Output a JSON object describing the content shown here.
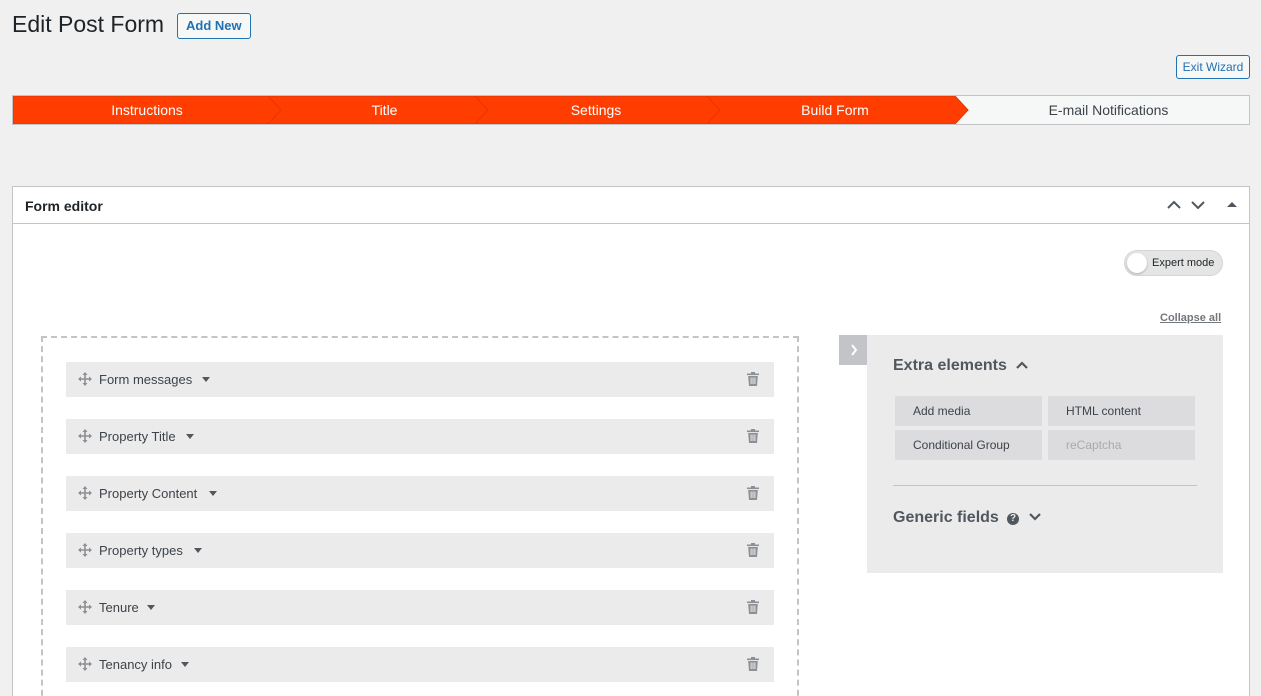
{
  "page": {
    "title": "Edit Post Form",
    "add_new_label": "Add New",
    "exit_wizard_label": "Exit Wizard"
  },
  "wizard": {
    "steps": [
      {
        "label": "Instructions",
        "active": true
      },
      {
        "label": "Title",
        "active": true
      },
      {
        "label": "Settings",
        "active": true
      },
      {
        "label": "Build Form",
        "active": true
      },
      {
        "label": "E-mail Notifications",
        "active": false
      }
    ],
    "active_color": "#ff3d00"
  },
  "form_editor": {
    "title": "Form editor",
    "expert_mode_label": "Expert mode",
    "collapse_all_label": "Collapse all",
    "fields": [
      {
        "label": "Form messages"
      },
      {
        "label": "Property Title"
      },
      {
        "label": "Property Content"
      },
      {
        "label": "Property types"
      },
      {
        "label": "Tenure"
      },
      {
        "label": "Tenancy info"
      }
    ]
  },
  "sidebar_panel": {
    "extra_elements_title": "Extra elements",
    "elements": [
      {
        "label": "Add media",
        "enabled": true
      },
      {
        "label": "HTML content",
        "enabled": true
      },
      {
        "label": "Conditional Group",
        "enabled": true
      },
      {
        "label": "reCaptcha",
        "enabled": false
      }
    ],
    "generic_fields_title": "Generic fields",
    "help_symbol": "?"
  },
  "icons": {
    "move": "move-icon",
    "trash": "trash-icon",
    "caret": "caret-down-icon",
    "chevron_up": "chevron-up-icon",
    "chevron_down": "chevron-down-icon",
    "toggle": "triangle-up-icon",
    "panel_toggle": "chevron-right-icon",
    "help": "help-icon"
  }
}
